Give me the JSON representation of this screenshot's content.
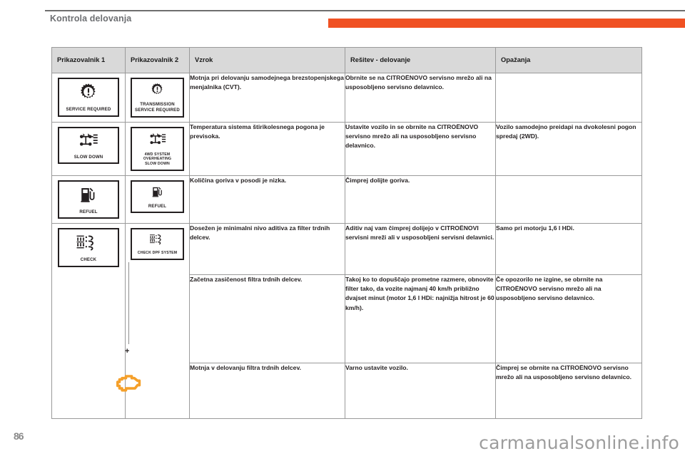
{
  "header": {
    "title": "Kontrola delovanja",
    "accent_color": "#f05123",
    "rule_color": "#6e6e6e"
  },
  "table": {
    "columns": [
      "Prikazovalnik 1",
      "Prikazovalnik 2",
      "Vzrok",
      "Rešitev - delovanje",
      "Opažanja"
    ],
    "rows": [
      {
        "indicator1": {
          "icon": "gear-warning-icon",
          "caption": "SERVICE REQUIRED"
        },
        "indicator2": {
          "icon": "gear-warning-icon",
          "caption": "TRANSMISSION\nSERVICE REQUIRED"
        },
        "cause": "Motnja pri delovanju samodejnega brezstopenjskega menjalnika (CVT).",
        "solution": "Obrnite se na CITROËNOVO servisno mrežo ali na usposobljeno servisno delavnico.",
        "remark": ""
      },
      {
        "indicator1": {
          "icon": "4wd-driveline-icon",
          "caption": "SLOW DOWN"
        },
        "indicator2": {
          "icon": "4wd-driveline-icon",
          "caption": "4WD SYSTEM OVERHEATING\nSLOW DOWN"
        },
        "cause": "Temperatura sistema štirikolesnega pogona je previsoka.",
        "solution": "Ustavite vozilo in se obrnite na CITROËNOVO servisno mrežo ali na usposobljeno servisno delavnico.",
        "remark": "Vozilo samodejno preidapi na dvokolesni pogon spredaj (2WD)."
      },
      {
        "indicator1": {
          "icon": "fuel-pump-icon",
          "caption": "REFUEL"
        },
        "indicator2": {
          "icon": "fuel-pump-icon",
          "caption": "REFUEL"
        },
        "cause": "Količina goriva v posodi je nizka.",
        "solution": "Čimprej dolijte goriva.",
        "remark": ""
      },
      {
        "indicator1": {
          "icon": "particle-filter-icon",
          "caption": "CHECK"
        },
        "indicator2": {
          "icon": "particle-filter-icon",
          "caption": "CHECK DPF SYSTEM"
        },
        "cause": "Dosežen je minimalni nivo aditiva za filter trdnih delcev.",
        "solution": "Aditiv naj vam čimprej dolijejo v CITROËNOVI servisni mreži ali v usposobljeni servisni delavnici.",
        "remark": "Samo pri motorju 1,6 l HDi."
      },
      {
        "indicator1": null,
        "indicator2": null,
        "cause": "Začetna zasičenost filtra trdnih delcev.",
        "solution": "Takoj ko to dopuščajo prometne razmere, obnovite filter tako, da vozite najmanj 40 km/h približno dvajset minut (motor 1,6 l HDi: najnižja hitrost je 60 km/h).",
        "remark": "Če opozorilo ne izgine, se obrnite na CITROËNOVO servisno mrežo ali na usposobljeno servisno delavnico."
      },
      {
        "indicator1": null,
        "indicator2": null,
        "cause": "Motnja v delovanju filtra trdnih delcev.",
        "solution": "Varno ustavite vozilo.",
        "remark": "Čimprej se obrnite na CITROËNOVO servisno mrežo ali na usposobljeno servisno delavnico."
      }
    ]
  },
  "annotation": {
    "plus": "+",
    "engine_icon": "engine-warning-icon",
    "engine_icon_color": "#f5a02a"
  },
  "footer": {
    "page_number": "86",
    "watermark": "carmanualsonline.info"
  }
}
